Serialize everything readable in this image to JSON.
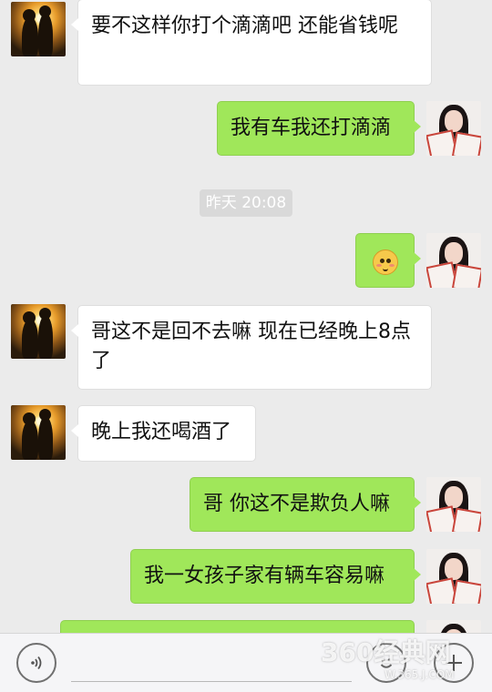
{
  "conversation": {
    "messages": [
      {
        "side": "in",
        "text": "要不这样你打个滴滴吧    还能省钱呢"
      },
      {
        "side": "out",
        "text": "我有车我还打滴滴"
      },
      {
        "side": "out",
        "emoji": "flushed-face"
      },
      {
        "side": "in",
        "text": "哥这不是回不去嘛  现在已经晚上8点了"
      },
      {
        "side": "in",
        "text": "晚上我还喝酒了"
      },
      {
        "side": "out",
        "text": "哥 你这不是欺负人嘛"
      },
      {
        "side": "out",
        "text": "我一女孩子家有辆车容易嘛"
      }
    ],
    "timestamp": "昨天 20:08"
  },
  "input_bar": {
    "voice_icon": "voice-icon",
    "emoji_icon": "emoji-icon",
    "plus_icon": "plus-icon",
    "input_value": ""
  },
  "watermark": {
    "text": "360经典网",
    "sub": "W.365.J.COM"
  },
  "colors": {
    "outgoing_bubble": "#a0e75a",
    "incoming_bubble": "#ffffff",
    "background": "#ebebeb"
  }
}
